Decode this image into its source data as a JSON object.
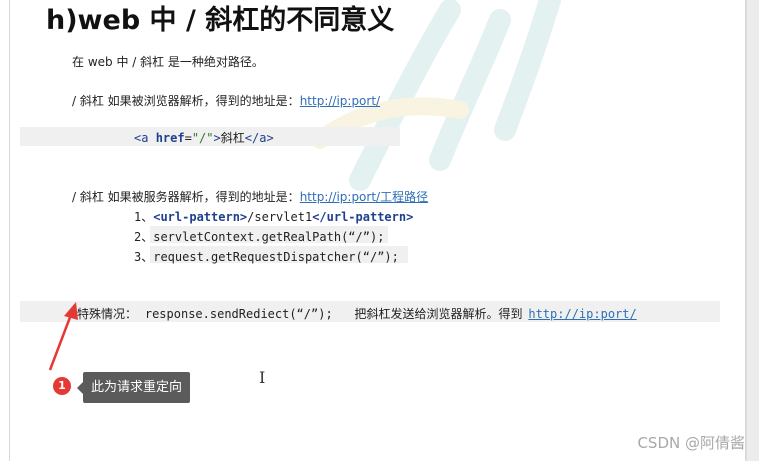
{
  "document": {
    "title": "h)web 中 / 斜杠的不同意义",
    "intro": "在 web 中 / 斜杠 是一种绝对路径。",
    "browser_line": {
      "text": "/ 斜杠 如果被浏览器解析，得到的地址是：",
      "link": "http://ip:port/"
    },
    "code_example": {
      "open_tag": "<a ",
      "attr": "href",
      "eq": "=",
      "value": "\"/\"",
      "close_open": ">",
      "inner": "斜杠",
      "close_tag": "</a>"
    },
    "server_line": {
      "text": "/ 斜杠 如果被服务器解析，得到的地址是：",
      "link": "http://ip:port/工程路径"
    },
    "server_items": {
      "item1": {
        "prefix": "1、",
        "tag_open": "<url-pattern>",
        "body": "/servlet1",
        "tag_close": "</url-pattern>"
      },
      "item2": "2、servletContext.getRealPath(“/”);",
      "item3": "3、request.getRequestDispatcher(“/”);"
    },
    "special": {
      "label": "特殊情况：",
      "code": "response.sendRediect(“/”);",
      "explain": "把斜杠发送给浏览器解析。得到",
      "link": "http://ip:port/"
    }
  },
  "annotation": {
    "badge": "1",
    "tooltip": "此为请求重定向",
    "color": "#e53935"
  },
  "watermark_text": "CSDN @阿倩酱"
}
